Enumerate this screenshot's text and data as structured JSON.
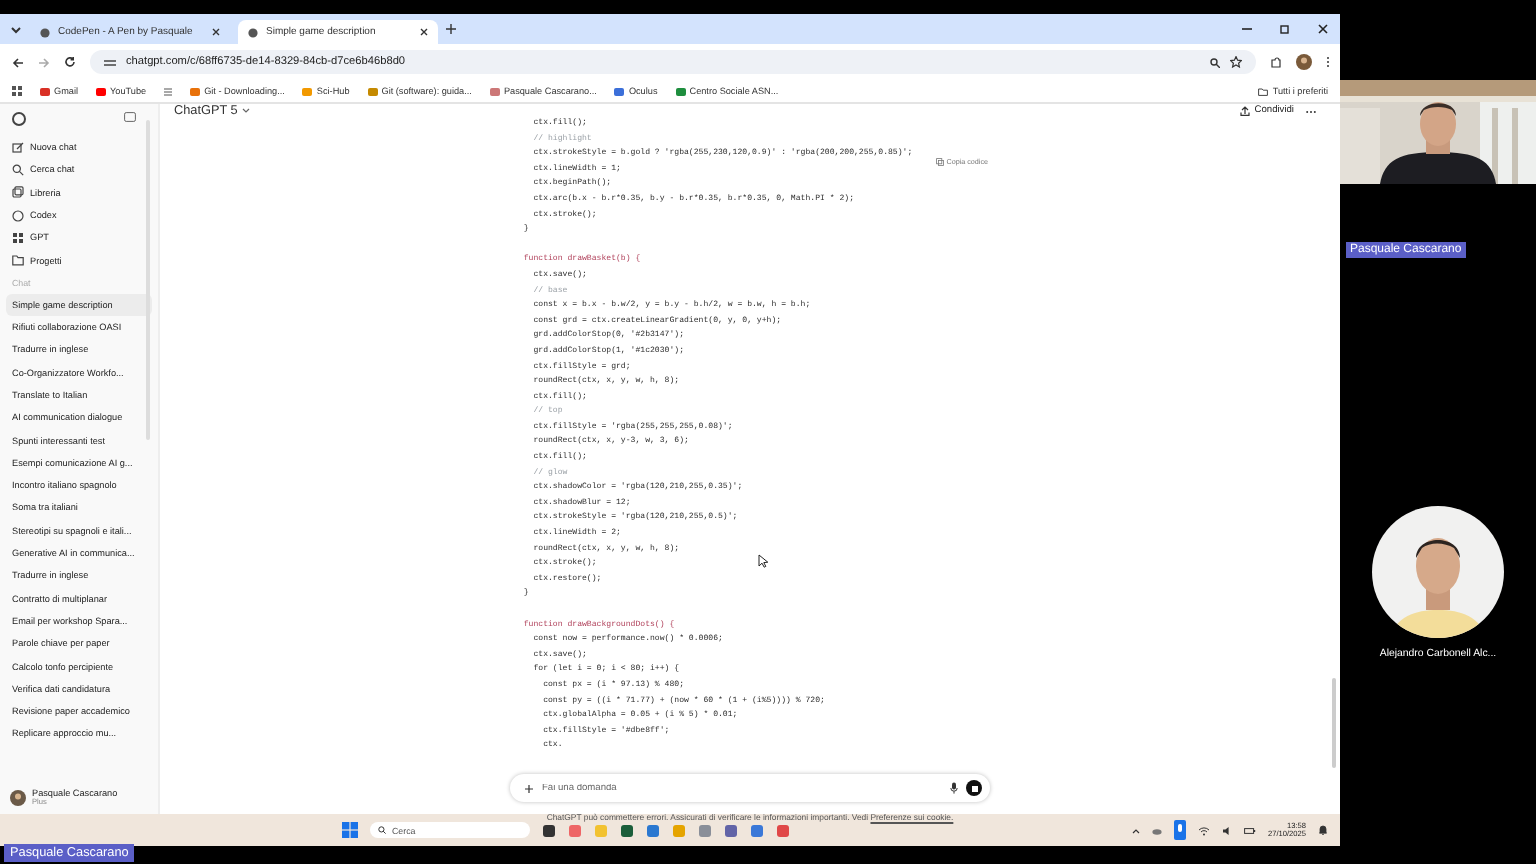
{
  "browser": {
    "tabs": [
      {
        "title": "CodePen - A Pen by Pasquale",
        "selected": false
      },
      {
        "title": "Simple game description",
        "selected": true
      }
    ],
    "url": "chatgpt.com/c/68ff6735-de14-8329-84cb-d7ce6b46b8d0",
    "bookmarks": [
      "Gmail",
      "YouTube",
      "Git - Downloading...",
      "Sci-Hub",
      "Git (software): guida...",
      "Pasquale Cascarano...",
      "Oculus",
      "Centro Sociale ASN..."
    ],
    "all_bookmarks": "Tutti i preferiti"
  },
  "sidebar": {
    "nav": [
      "Nuova chat",
      "Cerca chat",
      "Libreria",
      "Codex",
      "GPT",
      "Progetti"
    ],
    "section": "Chat",
    "chats": [
      {
        "title": "Simple game description",
        "selected": true
      },
      {
        "title": "Rifiuti collaborazione OASI",
        "selected": false
      },
      {
        "title": "Tradurre in inglese",
        "selected": false
      },
      {
        "title": "Co-Organizzatore Workfo...",
        "selected": false
      },
      {
        "title": "Translate to Italian",
        "selected": false
      },
      {
        "title": "AI communication dialogue",
        "selected": false
      },
      {
        "title": "Spunti interessanti test",
        "selected": false
      },
      {
        "title": "Esempi comunicazione AI g...",
        "selected": false
      },
      {
        "title": "Incontro italiano spagnolo",
        "selected": false
      },
      {
        "title": "Soma tra italiani",
        "selected": false
      },
      {
        "title": "Stereotipi su spagnoli e itali...",
        "selected": false
      },
      {
        "title": "Generative AI in communica...",
        "selected": false
      },
      {
        "title": "Tradurre in inglese",
        "selected": false
      },
      {
        "title": "Contratto di multiplanar",
        "selected": false
      },
      {
        "title": "Email per workshop Spara...",
        "selected": false
      },
      {
        "title": "Parole chiave per paper",
        "selected": false
      },
      {
        "title": "Calcolo tonfo percipiente",
        "selected": false
      },
      {
        "title": "Verifica dati candidatura",
        "selected": false
      },
      {
        "title": "Revisione paper accademico",
        "selected": false
      },
      {
        "title": "Replicare approccio mu...",
        "selected": false
      }
    ],
    "user": {
      "name": "Pasquale Cascarano",
      "plan": "Plus"
    }
  },
  "header": {
    "model": "ChatGPT 5",
    "share": "Condividi"
  },
  "code": {
    "copy": "Copia codice",
    "lines": [
      {
        "kind": "code",
        "text": "    ctx.fill();"
      },
      {
        "kind": "comment",
        "text": "    // highlight"
      },
      {
        "kind": "code",
        "text": "    ctx.strokeStyle = b.gold ? 'rgba(255,230,120,0.9)' : 'rgba(200,200,255,0.85)';"
      },
      {
        "kind": "code",
        "text": "    ctx.lineWidth = 1;"
      },
      {
        "kind": "code",
        "text": "    ctx.beginPath();"
      },
      {
        "kind": "code",
        "text": "    ctx.arc(b.x - b.r*0.35, b.y - b.r*0.35, b.r*0.35, 0, Math.PI * 2);"
      },
      {
        "kind": "code",
        "text": "    ctx.stroke();"
      },
      {
        "kind": "code",
        "text": "  }"
      },
      {
        "kind": "blank"
      },
      {
        "kind": "keyword",
        "text": "  function drawBasket(b) {"
      },
      {
        "kind": "code",
        "text": "    ctx.save();"
      },
      {
        "kind": "comment",
        "text": "    // base"
      },
      {
        "kind": "code",
        "text": "    const x = b.x - b.w/2, y = b.y - b.h/2, w = b.w, h = b.h;"
      },
      {
        "kind": "code",
        "text": "    const grd = ctx.createLinearGradient(0, y, 0, y+h);"
      },
      {
        "kind": "code",
        "text": "    grd.addColorStop(0, '#2b3147');"
      },
      {
        "kind": "code",
        "text": "    grd.addColorStop(1, '#1c2030');"
      },
      {
        "kind": "code",
        "text": "    ctx.fillStyle = grd;"
      },
      {
        "kind": "code",
        "text": "    roundRect(ctx, x, y, w, h, 8);"
      },
      {
        "kind": "code",
        "text": "    ctx.fill();"
      },
      {
        "kind": "comment",
        "text": "    // top"
      },
      {
        "kind": "code",
        "text": "    ctx.fillStyle = 'rgba(255,255,255,0.08)';"
      },
      {
        "kind": "code",
        "text": "    roundRect(ctx, x, y-3, w, 3, 6);"
      },
      {
        "kind": "code",
        "text": "    ctx.fill();"
      },
      {
        "kind": "comment",
        "text": "    // glow"
      },
      {
        "kind": "code",
        "text": "    ctx.shadowColor = 'rgba(120,210,255,0.35)';"
      },
      {
        "kind": "code",
        "text": "    ctx.shadowBlur = 12;"
      },
      {
        "kind": "code",
        "text": "    ctx.strokeStyle = 'rgba(120,210,255,0.5)';"
      },
      {
        "kind": "code",
        "text": "    ctx.lineWidth = 2;"
      },
      {
        "kind": "code",
        "text": "    roundRect(ctx, x, y, w, h, 8);"
      },
      {
        "kind": "code",
        "text": "    ctx.stroke();"
      },
      {
        "kind": "code",
        "text": "    ctx.restore();"
      },
      {
        "kind": "code",
        "text": "  }"
      },
      {
        "kind": "blank"
      },
      {
        "kind": "keyword",
        "text": "  function drawBackgroundDots() {"
      },
      {
        "kind": "code",
        "text": "    const now = performance.now() * 0.0006;"
      },
      {
        "kind": "code",
        "text": "    ctx.save();"
      },
      {
        "kind": "code",
        "text": "    for (let i = 0; i < 80; i++) {"
      },
      {
        "kind": "code",
        "text": "      const px = (i * 97.13) % 480;"
      },
      {
        "kind": "code",
        "text": "      const py = ((i * 71.77) + (now * 60 * (1 + (i%5)))) % 720;"
      },
      {
        "kind": "code",
        "text": "      ctx.globalAlpha = 0.05 + (i % 5) * 0.01;"
      },
      {
        "kind": "code",
        "text": "      ctx.fillStyle = '#dbe8ff';"
      },
      {
        "kind": "code",
        "text": "      ctx."
      }
    ]
  },
  "composer": {
    "placeholder": "Fai una domanda"
  },
  "disclaimer": {
    "text": "ChatGPT può commettere errori. Assicurati di verificare le informazioni importanti. Vedi",
    "link": "Preferenze sui cookie."
  },
  "taskbar": {
    "search": "Cerca",
    "time": "13:58",
    "date": "27/10/2025"
  },
  "call": {
    "participants": [
      {
        "kind": "video",
        "name": "Pasquale Cascarano"
      },
      {
        "kind": "avatar",
        "name": "Alejandro Carbonell Alc..."
      }
    ],
    "presenter": "Pasquale Cascarano"
  }
}
